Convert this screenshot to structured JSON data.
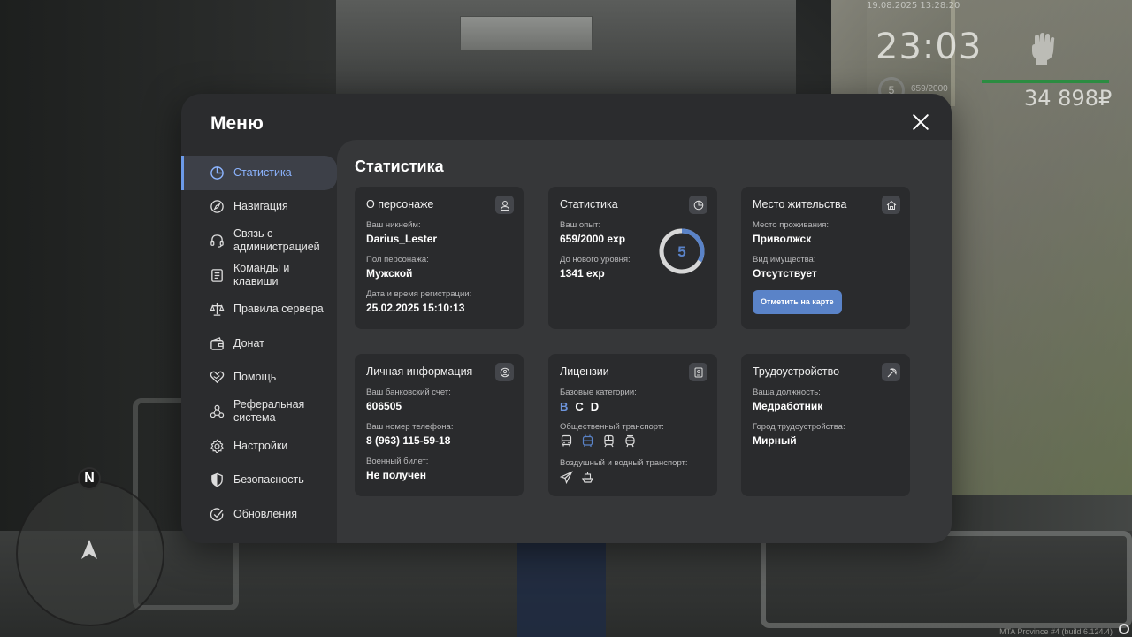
{
  "hud": {
    "datetime": "19.08.2025 13:28:20",
    "clock": "23:03",
    "level": "5",
    "exp": "659/2000",
    "money": "34 898₽",
    "build": "MTA Province #4 (build 6.124.4)"
  },
  "minimap": {
    "north_label": "N"
  },
  "menu": {
    "title": "Меню",
    "sidebar": [
      {
        "label": "Статистика",
        "icon": "pie-chart-icon",
        "active": true
      },
      {
        "label": "Навигация",
        "icon": "compass-icon"
      },
      {
        "label": "Связь с администрацией",
        "icon": "headset-icon"
      },
      {
        "label": "Команды и клавиши",
        "icon": "document-icon"
      },
      {
        "label": "Правила сервера",
        "icon": "scales-icon"
      },
      {
        "label": "Донат",
        "icon": "wallet-icon"
      },
      {
        "label": "Помощь",
        "icon": "heart-hand-icon"
      },
      {
        "label": "Реферальная система",
        "icon": "network-icon"
      },
      {
        "label": "Настройки",
        "icon": "gear-icon"
      },
      {
        "label": "Безопасность",
        "icon": "shield-icon"
      },
      {
        "label": "Обновления",
        "icon": "check-circle-icon"
      }
    ]
  },
  "content": {
    "title": "Статистика",
    "character": {
      "title": "О персонаже",
      "nick_label": "Ваш никнейм:",
      "nick": "Darius_Lester",
      "sex_label": "Пол персонажа:",
      "sex": "Мужской",
      "reg_label": "Дата и время регистрации:",
      "reg": "25.02.2025 15:10:13"
    },
    "stats": {
      "title": "Статистика",
      "exp_label": "Ваш опыт:",
      "exp": "659/2000 exp",
      "next_label": "До нового уровня:",
      "next": "1341 exp",
      "level": "5",
      "progress": 0.3295
    },
    "residence": {
      "title": "Место жительства",
      "place_label": "Место проживания:",
      "place": "Приволжск",
      "property_label": "Вид имущества:",
      "property": "Отсутствует",
      "map_button": "Отметить на карте"
    },
    "personal": {
      "title": "Личная информация",
      "bank_label": "Ваш банковский счет:",
      "bank": "606505",
      "phone_label": "Ваш номер телефона:",
      "phone": "8 (963) 115-59-18",
      "military_label": "Военный билет:",
      "military": "Не получен"
    },
    "licenses": {
      "title": "Лицензии",
      "base_label": "Базовые категории:",
      "categories": [
        "B",
        "C",
        "D"
      ],
      "public_label": "Общественный транспорт:",
      "public_icons": [
        "bus-icon",
        "trolleybus-icon",
        "train-icon",
        "tram-icon"
      ],
      "air_label": "Воздушный и водный транспорт:",
      "air_icons": [
        "plane-icon",
        "ship-icon"
      ]
    },
    "employment": {
      "title": "Трудоустройство",
      "position_label": "Ваша должность:",
      "position": "Медработник",
      "city_label": "Город трудоустройства:",
      "city": "Мирный"
    }
  },
  "colors": {
    "accent": "#5a83c8",
    "active_text": "#8cb4ff",
    "panel": "#2b2c2e",
    "content": "#363739",
    "card": "#2a2b2d"
  }
}
